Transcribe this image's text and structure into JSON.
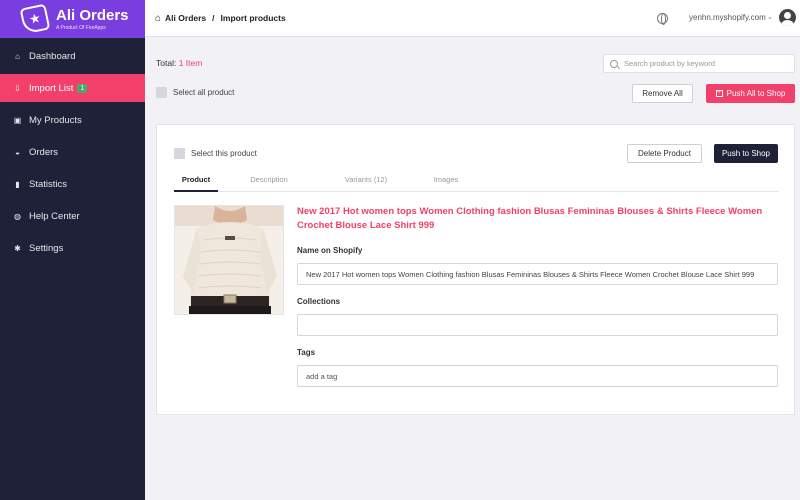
{
  "brand": {
    "title": "Ali Orders",
    "subtitle": "A Product Of FireApps"
  },
  "sidebar": {
    "items": [
      {
        "label": "Dashboard",
        "icon": "home-icon"
      },
      {
        "label": "Import List",
        "icon": "import-icon",
        "badge": "1",
        "active": true
      },
      {
        "label": "My Products",
        "icon": "box-icon"
      },
      {
        "label": "Orders",
        "icon": "basket-icon"
      },
      {
        "label": "Statistics",
        "icon": "bar-chart-icon"
      },
      {
        "label": "Help Center",
        "icon": "globe-icon"
      },
      {
        "label": "Settings",
        "icon": "gear-icon"
      }
    ]
  },
  "header": {
    "breadcrumb": [
      "Ali Orders",
      "Import products"
    ],
    "separator": "/",
    "store": "yenhn.myshopify.com"
  },
  "toolbar": {
    "total_label": "Total:",
    "total_count": "1 Item",
    "search_placeholder": "Search product by keyword",
    "select_all_label": "Select all product",
    "remove_all_label": "Remove All",
    "push_all_label": "Push All to Shop"
  },
  "product": {
    "select_label": "Select this product",
    "delete_label": "Delete Product",
    "push_label": "Push to Shop",
    "tabs": [
      "Product",
      "Description",
      "Variants (12)",
      "Images"
    ],
    "active_tab": "Product",
    "title": "New 2017 Hot women tops Women Clothing fashion Blusas Femininas Blouses & Shirts Fleece Women Crochet Blouse Lace Shirt 999",
    "name_label": "Name on Shopify",
    "name_value": "New 2017  Hot women tops Women Clothing  fashion Blusas Femininas Blouses & Shirts Fleece Women Crochet Blouse Lace Shirt 999",
    "collections_label": "Collections",
    "collections_value": "",
    "tags_label": "Tags",
    "tags_placeholder": "add a tag"
  },
  "colors": {
    "accent": "#f1416a",
    "sidebar": "#1f2139",
    "brand": "#7a3de0"
  }
}
